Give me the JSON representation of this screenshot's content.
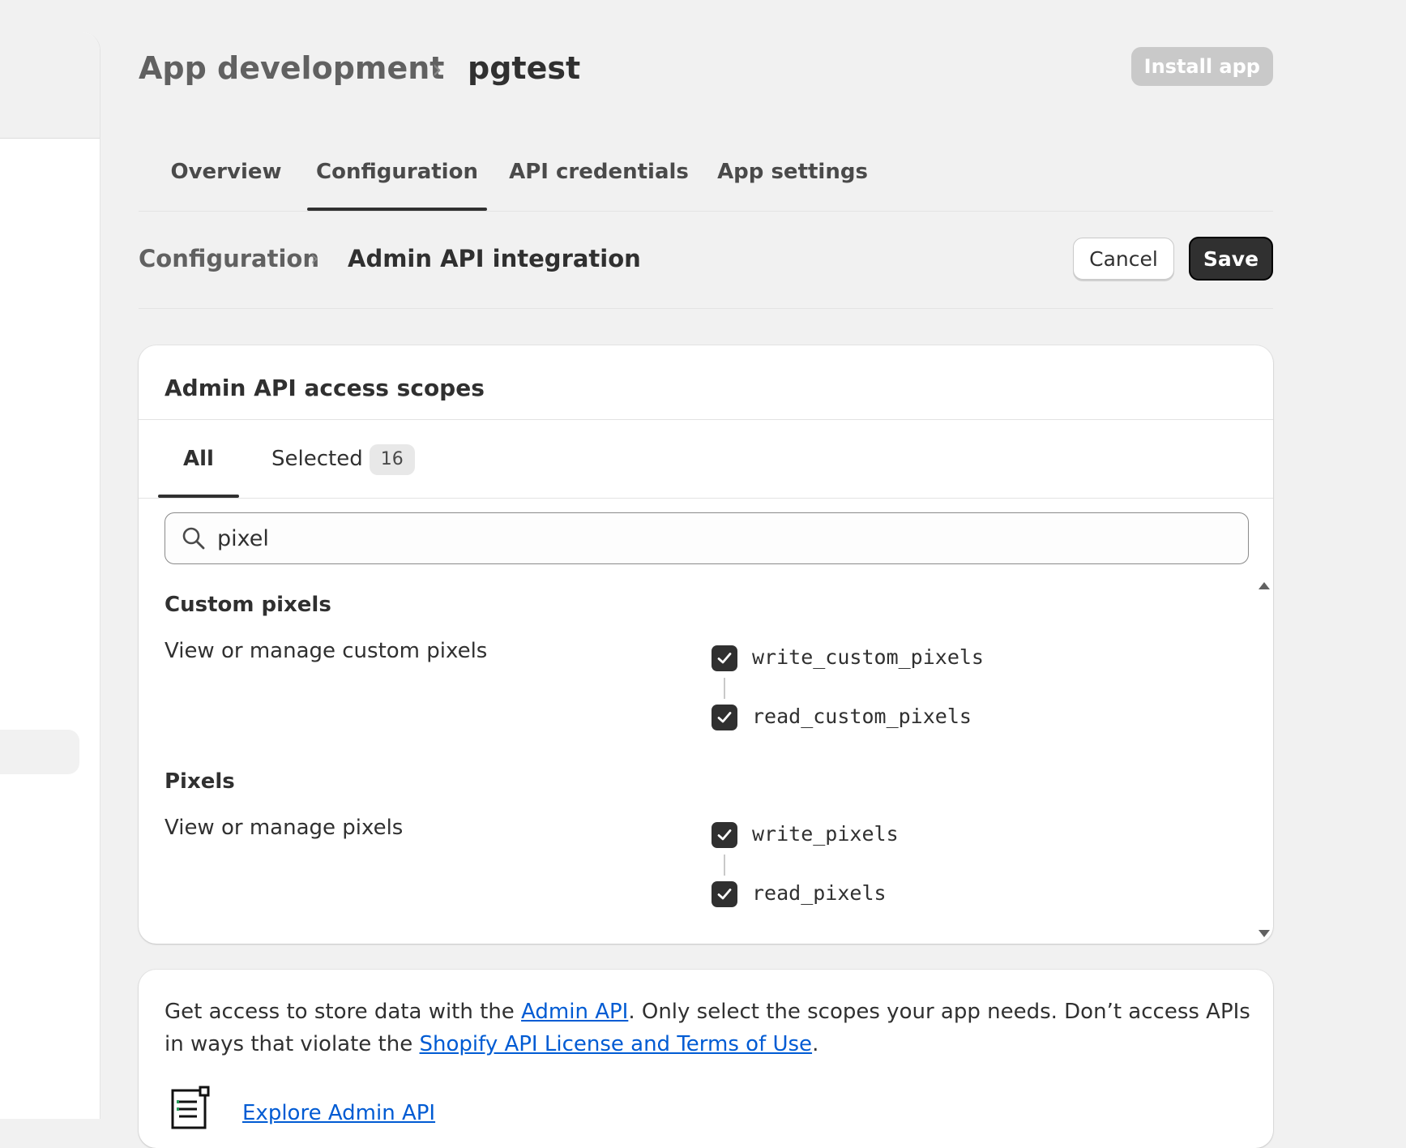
{
  "header": {
    "breadcrumb_parent": "App development",
    "breadcrumb_current": "pgtest",
    "install_label": "Install app"
  },
  "tabs": [
    {
      "label": "Overview"
    },
    {
      "label": "Configuration"
    },
    {
      "label": "API credentials"
    },
    {
      "label": "App settings"
    }
  ],
  "sub_header": {
    "breadcrumb_parent": "Configuration",
    "breadcrumb_current": "Admin API integration",
    "cancel_label": "Cancel",
    "save_label": "Save"
  },
  "scopes_card": {
    "title": "Admin API access scopes",
    "tabs": [
      {
        "label": "All"
      },
      {
        "label": "Selected",
        "count": "16"
      }
    ],
    "search_value": "pixel",
    "groups": [
      {
        "title": "Custom pixels",
        "description": "View or manage custom pixels",
        "scopes": [
          {
            "label": "write_custom_pixels",
            "checked": true
          },
          {
            "label": "read_custom_pixels",
            "checked": true
          }
        ]
      },
      {
        "title": "Pixels",
        "description": "View or manage pixels",
        "scopes": [
          {
            "label": "write_pixels",
            "checked": true
          },
          {
            "label": "read_pixels",
            "checked": true
          }
        ]
      }
    ]
  },
  "info_card": {
    "text_1": "Get access to store data with the ",
    "link_admin_api": "Admin API",
    "text_2": ". Only select the scopes your app needs. Don’t access APIs in ways that violate the ",
    "link_terms": "Shopify API License and Terms of Use",
    "text_3": ".",
    "explore_link": "Explore Admin API"
  }
}
